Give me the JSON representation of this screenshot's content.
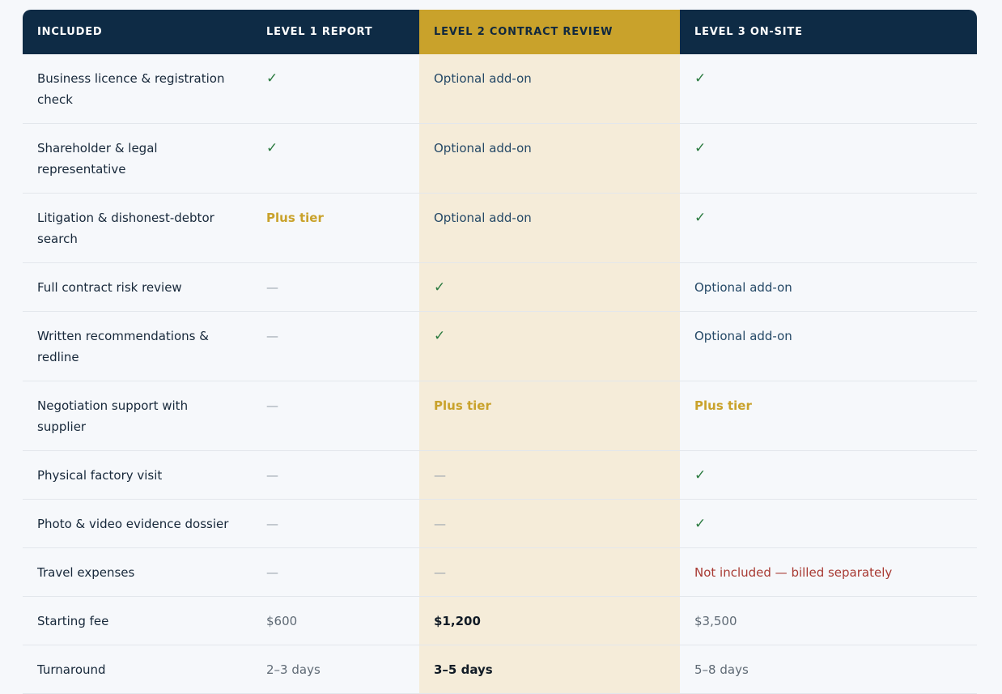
{
  "headers": [
    "INCLUDED",
    "LEVEL 1 REPORT",
    "LEVEL 2 CONTRACT REVIEW",
    "LEVEL 3 ON-SITE"
  ],
  "rows": [
    {
      "label": "Business licence & registration check",
      "cells": [
        {
          "text": "✓",
          "kind": "check"
        },
        {
          "text": "Optional add-on",
          "kind": "addon"
        },
        {
          "text": "✓",
          "kind": "check"
        }
      ]
    },
    {
      "label": "Shareholder & legal representative",
      "cells": [
        {
          "text": "✓",
          "kind": "check"
        },
        {
          "text": "Optional add-on",
          "kind": "addon"
        },
        {
          "text": "✓",
          "kind": "check"
        }
      ]
    },
    {
      "label": "Litigation & dishonest-debtor search",
      "cells": [
        {
          "text": "Plus tier",
          "kind": "plus"
        },
        {
          "text": "Optional add-on",
          "kind": "addon"
        },
        {
          "text": "✓",
          "kind": "check"
        }
      ]
    },
    {
      "label": "Full contract risk review",
      "cells": [
        {
          "text": "—",
          "kind": "dash"
        },
        {
          "text": "✓",
          "kind": "check"
        },
        {
          "text": "Optional add-on",
          "kind": "addon"
        }
      ]
    },
    {
      "label": "Written recommendations & redline",
      "cells": [
        {
          "text": "—",
          "kind": "dash"
        },
        {
          "text": "✓",
          "kind": "check"
        },
        {
          "text": "Optional add-on",
          "kind": "addon"
        }
      ]
    },
    {
      "label": "Negotiation support with supplier",
      "cells": [
        {
          "text": "—",
          "kind": "dash"
        },
        {
          "text": "Plus tier",
          "kind": "plus"
        },
        {
          "text": "Plus tier",
          "kind": "plus"
        }
      ]
    },
    {
      "label": "Physical factory visit",
      "cells": [
        {
          "text": "—",
          "kind": "dash"
        },
        {
          "text": "—",
          "kind": "dash"
        },
        {
          "text": "✓",
          "kind": "check"
        }
      ]
    },
    {
      "label": "Photo & video evidence dossier",
      "cells": [
        {
          "text": "—",
          "kind": "dash"
        },
        {
          "text": "—",
          "kind": "dash"
        },
        {
          "text": "✓",
          "kind": "check"
        }
      ]
    },
    {
      "label": "Travel expenses",
      "cells": [
        {
          "text": "—",
          "kind": "dash"
        },
        {
          "text": "—",
          "kind": "dash"
        },
        {
          "text": "Not included — billed separately",
          "kind": "excluded"
        }
      ]
    },
    {
      "label": "Starting fee",
      "cells": [
        {
          "text": "$600",
          "kind": "plain"
        },
        {
          "text": "$1,200",
          "kind": "bold"
        },
        {
          "text": "$3,500",
          "kind": "plain"
        }
      ]
    },
    {
      "label": "Turnaround",
      "cells": [
        {
          "text": "2–3 days",
          "kind": "plain"
        },
        {
          "text": "3–5 days",
          "kind": "bold"
        },
        {
          "text": "5–8 days",
          "kind": "plain"
        }
      ]
    }
  ],
  "colors": {
    "header_bg": "#0e2b45",
    "highlight_header_bg": "#c9a22b",
    "highlight_column_bg": "#f5ecd9",
    "check": "#2a7a3f",
    "addon": "#244866",
    "plus_tier": "#c9a22b",
    "excluded": "#a83a33"
  }
}
